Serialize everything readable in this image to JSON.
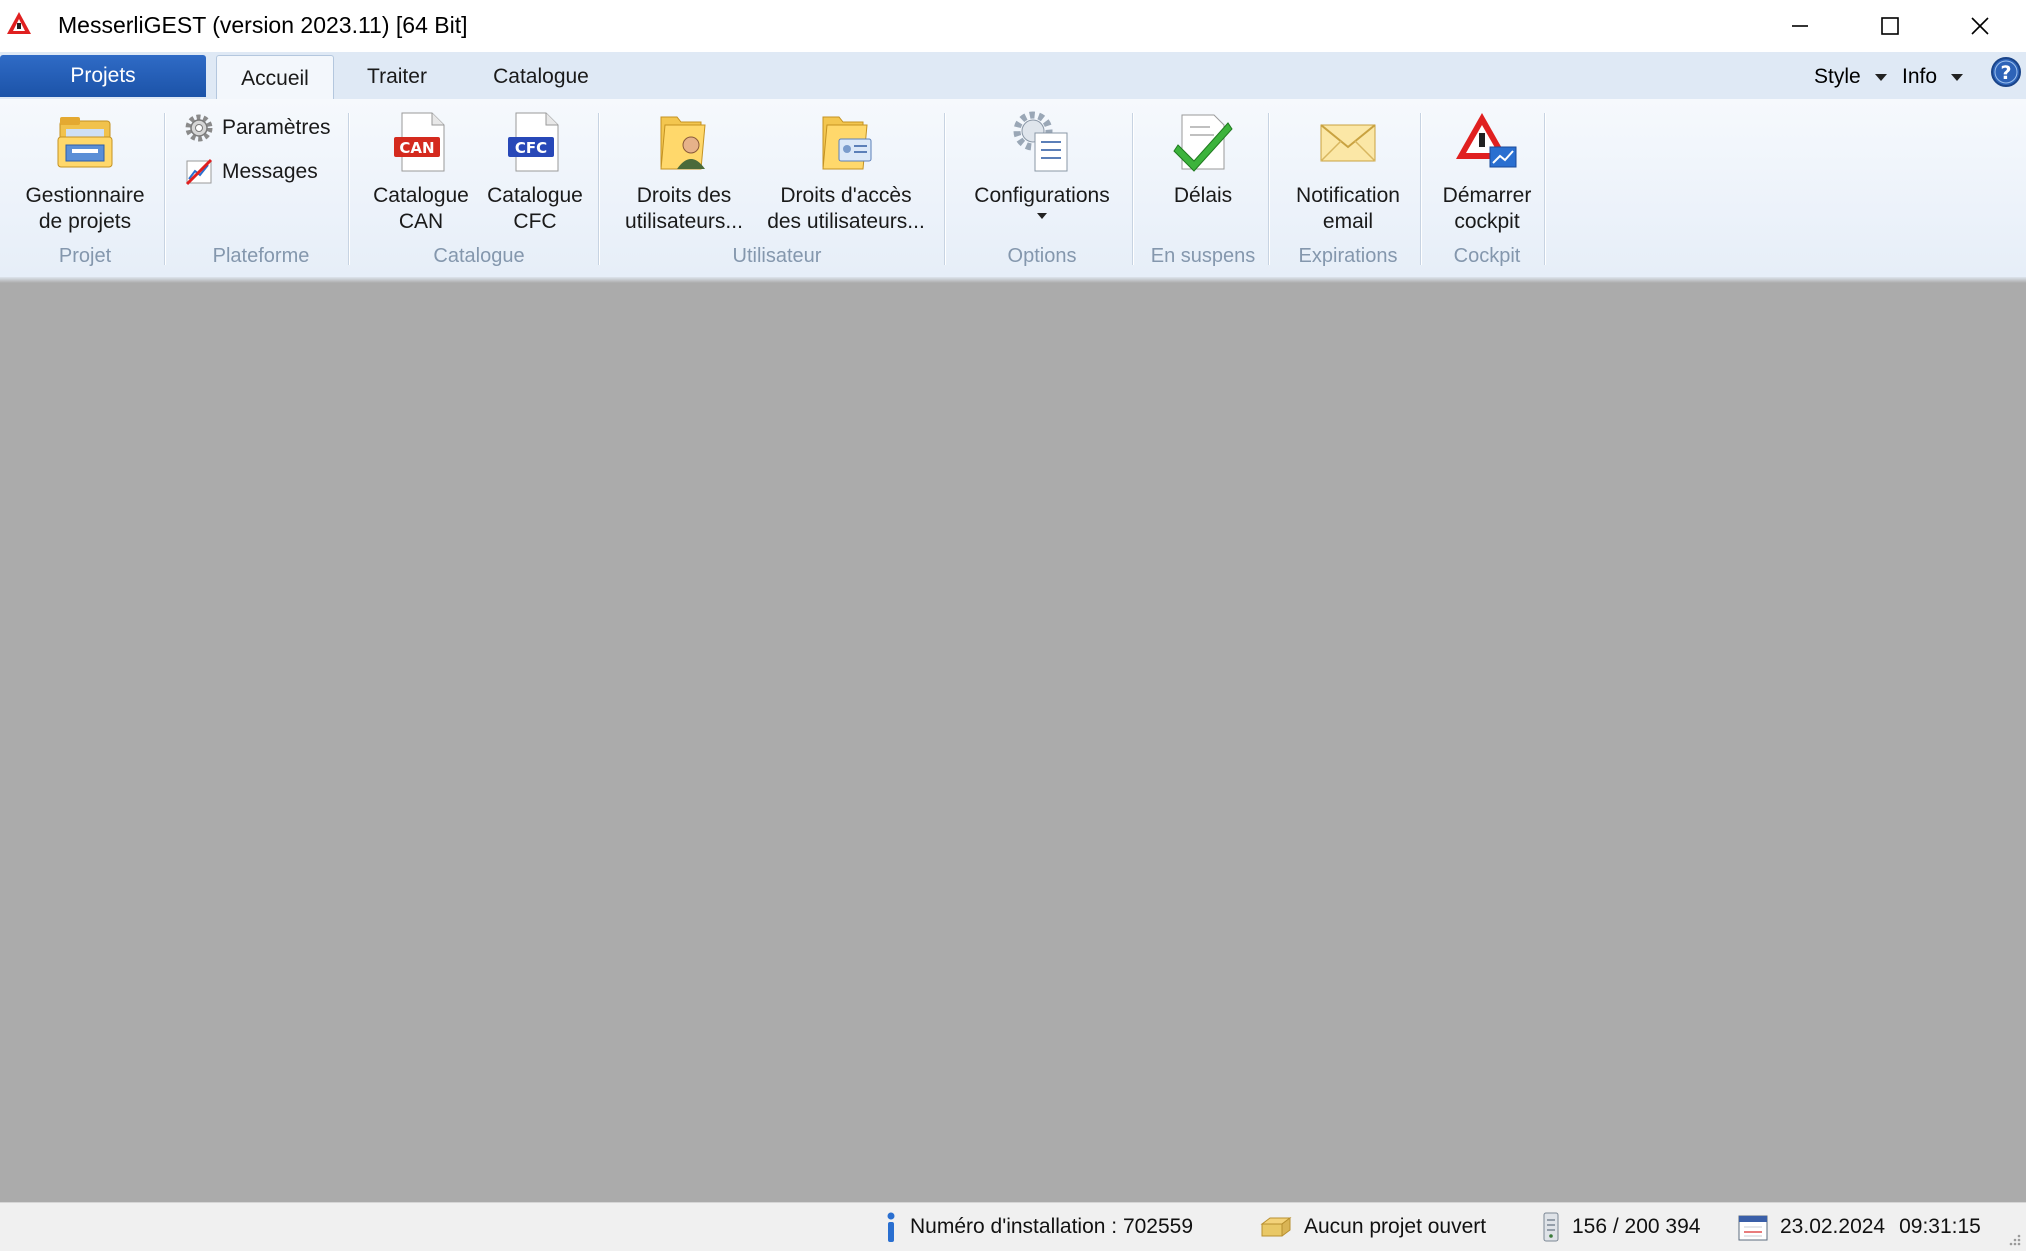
{
  "window": {
    "title": "MesserliGEST (version 2023.11)  [64 Bit]",
    "app_icon": "messerli-warning-triangle-icon",
    "controls": [
      "minimize-icon",
      "maximize-icon",
      "close-icon"
    ]
  },
  "tabs": {
    "projets": "Projets",
    "accueil": "Accueil",
    "traiter": "Traiter",
    "catalogue": "Catalogue",
    "active": "Accueil"
  },
  "menus": {
    "style": "Style",
    "info": "Info",
    "help_icon": "help-question-icon"
  },
  "ribbon": {
    "groups": {
      "projet": "Projet",
      "plateforme": "Plateforme",
      "catalogue": "Catalogue",
      "utilisateur": "Utilisateur",
      "options": "Options",
      "en_suspens": "En suspens",
      "expirations": "Expirations",
      "cockpit": "Cockpit"
    },
    "buttons": {
      "gestionnaire_l1": "Gestionnaire",
      "gestionnaire_l2": "de projets",
      "parametres": "Paramètres",
      "messages": "Messages",
      "cat_can_l1": "Catalogue",
      "cat_can_l2": "CAN",
      "can_badge": "CAN",
      "cat_cfc_l1": "Catalogue",
      "cat_cfc_l2": "CFC",
      "cfc_badge": "CFC",
      "droits_l1": "Droits des",
      "droits_l2": "utilisateurs...",
      "acces_l1": "Droits d'accès",
      "acces_l2": "des utilisateurs...",
      "configurations": "Configurations",
      "delais": "Délais",
      "notif_l1": "Notification",
      "notif_l2": "email",
      "cockpit_l1": "Démarrer",
      "cockpit_l2": "cockpit"
    }
  },
  "statusbar": {
    "installation": "Numéro d'installation : 702559",
    "project": "Aucun projet ouvert",
    "count": "156 / 200 394",
    "date": "23.02.2024",
    "time": "09:31:15"
  },
  "colors": {
    "projets_tab": "#1c53a8",
    "workspace": "#ababab",
    "ribbon": "#e6eef8",
    "group_label": "#8497ad"
  }
}
